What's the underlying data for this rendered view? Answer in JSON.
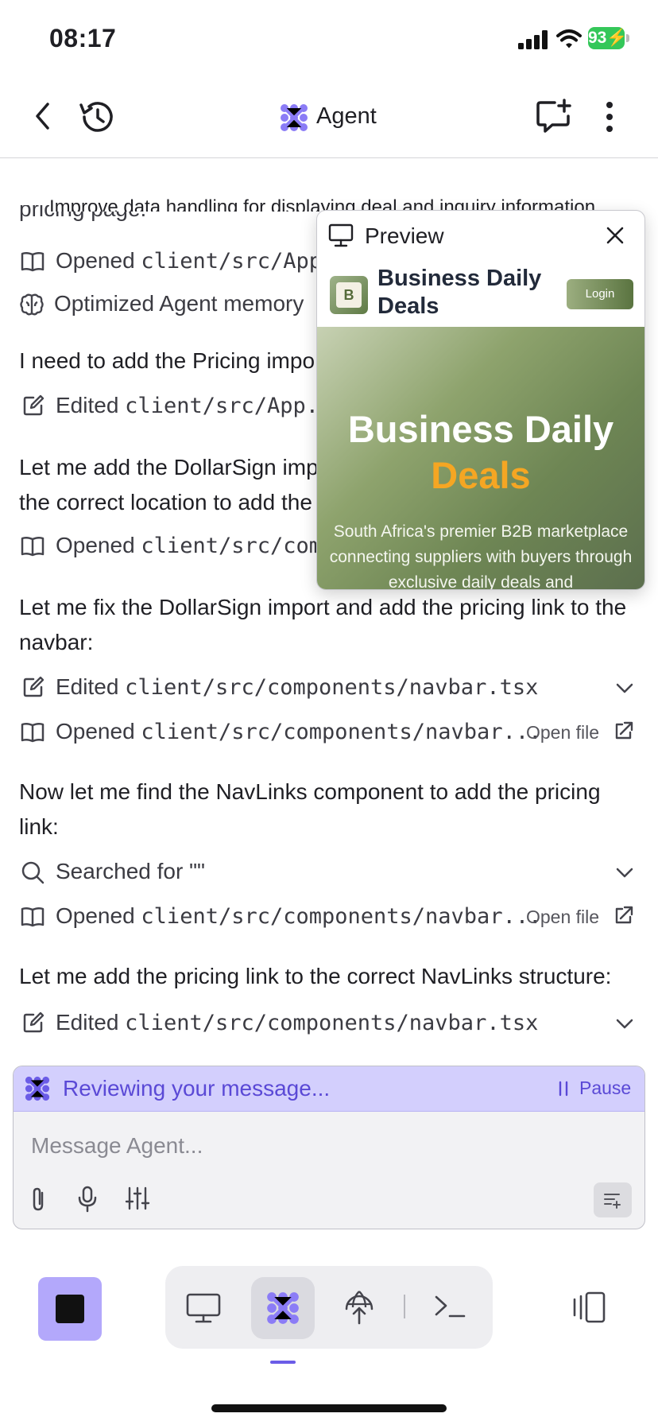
{
  "status_bar": {
    "time": "08:17",
    "battery": "93"
  },
  "header": {
    "title": "Agent"
  },
  "chat": {
    "top_text": "Improve data handling for displaying deal and inquiry information",
    "top_cut_text": "pricing page:",
    "rows": [
      {
        "icon": "book-icon",
        "prefix": "Opened ",
        "file": "client/src/App"
      },
      {
        "icon": "brain-icon",
        "prefix": "Optimized Agent memory",
        "file": ""
      },
      {
        "icon": "edit-icon",
        "prefix": "Edited ",
        "file": "client/src/App.t"
      },
      {
        "icon": "book-icon",
        "prefix": "Opened ",
        "file": "client/src/comp"
      }
    ],
    "para1": "I need to add the Pricing impo",
    "para2_line1": "Let me add the DollarSign imp",
    "para2_line2": "the correct location to add the",
    "para3": "Let me fix the DollarSign import and add the pricing link to the navbar:",
    "row_edit_navbar_1": {
      "prefix": "Edited ",
      "file": "client/src/components/navbar.tsx"
    },
    "row_open_navbar_1": {
      "prefix": "Opened ",
      "file": "client/src/components/navbar...",
      "action": "Open file"
    },
    "para4": "Now let me find the NavLinks component to add the pricing link:",
    "row_search": {
      "text": "Searched for \"\""
    },
    "row_open_navbar_2": {
      "prefix": "Opened ",
      "file": "client/src/components/navbar...",
      "action": "Open file"
    },
    "para5": "Let me add the pricing link to the correct NavLinks structure:",
    "row_edit_navbar_2": {
      "prefix": "Edited ",
      "file": "client/src/components/navbar.tsx"
    }
  },
  "preview": {
    "title": "Preview",
    "site_logo_letter": "B",
    "site_name": "Business Daily Deals",
    "login_label": "Login",
    "hero_title": "Business Daily",
    "hero_highlight": "Deals",
    "hero_subtitle": "South Africa's premier B2B marketplace connecting suppliers with buyers through exclusive daily deals and"
  },
  "composer": {
    "status_text": "Reviewing your message...",
    "pause_label": "Pause",
    "placeholder": "Message Agent..."
  },
  "colors": {
    "accent": "#6b5ce7",
    "reviewing_bg": "#d3cffd",
    "stop_bg": "#b3a8fb",
    "hero_highlight": "#f5a623",
    "battery": "#34c759"
  }
}
